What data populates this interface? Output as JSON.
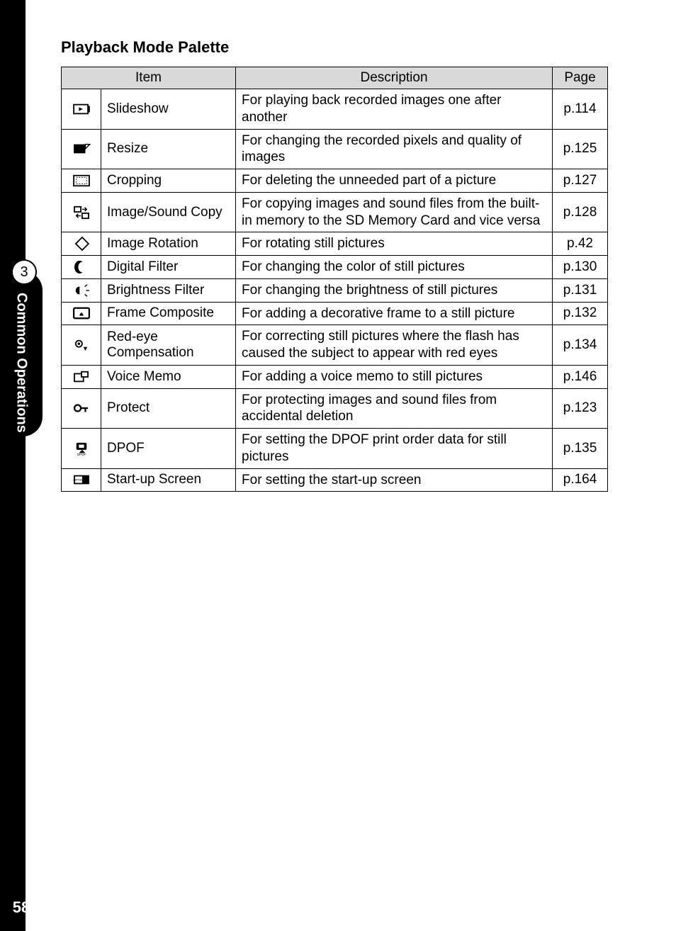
{
  "chapter": {
    "number": "3",
    "label": "Common Operations"
  },
  "page_number": "58",
  "title": "Playback Mode Palette",
  "headers": {
    "item": "Item",
    "description": "Description",
    "page": "Page"
  },
  "rows": [
    {
      "icon": "slideshow",
      "item": "Slideshow",
      "desc": "For playing back recorded images one after another",
      "page": "p.114"
    },
    {
      "icon": "resize",
      "item": "Resize",
      "desc": "For changing the recorded pixels and quality of images",
      "page": "p.125"
    },
    {
      "icon": "crop",
      "item": "Cropping",
      "desc": "For deleting the unneeded part of a picture",
      "page": "p.127"
    },
    {
      "icon": "copy",
      "item": "Image/Sound Copy",
      "desc": "For copying images and sound files from the built-in memory to the SD Memory Card and vice versa",
      "page": "p.128"
    },
    {
      "icon": "rotate",
      "item": "Image Rotation",
      "desc": "For rotating still pictures",
      "page": "p.42"
    },
    {
      "icon": "digital-filter",
      "item": "Digital Filter",
      "desc": "For changing the color of still pictures",
      "page": "p.130"
    },
    {
      "icon": "brightness",
      "item": "Brightness Filter",
      "desc": "For changing the brightness of still pictures",
      "page": "p.131"
    },
    {
      "icon": "frame",
      "item": "Frame Composite",
      "desc": "For adding a decorative frame to a still picture",
      "page": "p.132"
    },
    {
      "icon": "redeye",
      "item": "Red-eye Compensation",
      "desc": "For correcting still pictures where the flash has caused the subject to appear with red eyes",
      "page": "p.134"
    },
    {
      "icon": "voice-memo",
      "item": "Voice Memo",
      "desc": "For adding a voice memo to still pictures",
      "page": "p.146"
    },
    {
      "icon": "protect",
      "item": "Protect",
      "desc": "For protecting images and sound files from accidental deletion",
      "page": "p.123"
    },
    {
      "icon": "dpof",
      "item": "DPOF",
      "desc": "For setting the DPOF print order data for still pictures",
      "page": "p.135"
    },
    {
      "icon": "startup",
      "item": "Start-up Screen",
      "desc": "For setting the start-up screen",
      "page": "p.164"
    }
  ]
}
